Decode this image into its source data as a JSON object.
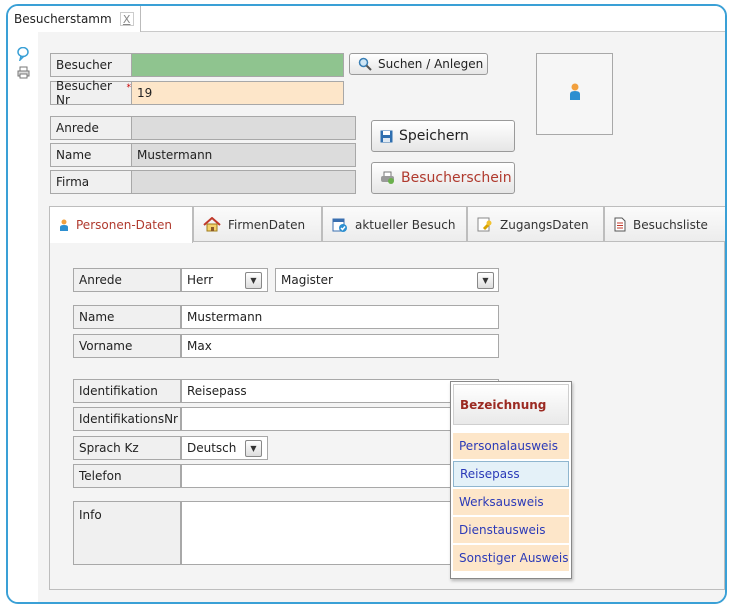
{
  "window": {
    "tab_title": "Besucherstamm",
    "tab_close": "X"
  },
  "header": {
    "besucher_label": "Besucher",
    "besucher_value": "",
    "besucher_nr_label": "Besucher Nr",
    "required_mark": "*",
    "besucher_nr_value": "19",
    "search_button": "Suchen / Anlegen",
    "anrede_label": "Anrede",
    "anrede_value": "",
    "name_label": "Name",
    "name_value": "Mustermann",
    "firma_label": "Firma",
    "firma_value": "",
    "save_button": "Speichern",
    "pass_button": "Besucherschein"
  },
  "tabs": [
    {
      "label": "Personen-Daten",
      "icon": "person-icon"
    },
    {
      "label": "FirmenDaten",
      "icon": "house-icon"
    },
    {
      "label": "aktueller Besuch",
      "icon": "calendar-check-icon"
    },
    {
      "label": "ZugangsDaten",
      "icon": "key-icon"
    },
    {
      "label": "Besuchsliste",
      "icon": "document-icon"
    }
  ],
  "form": {
    "anrede_label": "Anrede",
    "anrede_value": "Herr",
    "titel_value": "Magister",
    "name_label": "Name",
    "name_value": "Mustermann",
    "vorname_label": "Vorname",
    "vorname_value": "Max",
    "identifikation_label": "Identifikation",
    "identifikation_value": "Reisepass",
    "identnr_label": "IdentifikationsNr",
    "identnr_value": "",
    "sprach_label": "Sprach Kz",
    "sprach_value": "Deutsch",
    "telefon_label": "Telefon",
    "telefon_value": "",
    "info_label": "Info",
    "info_value": ""
  },
  "dropdown": {
    "header": "Bezeichnung",
    "options": [
      "Personalausweis",
      "Reisepass",
      "Werksausweis",
      "Dienstausweis",
      "Sonstiger Ausweis"
    ],
    "selected": "Reisepass"
  },
  "colors": {
    "accent": "#3aa0d6",
    "besucher_field": "#8fc48f",
    "nr_field": "#fde6c9",
    "disabled_field": "#dcdcdc",
    "red_text": "#b03a2e"
  }
}
